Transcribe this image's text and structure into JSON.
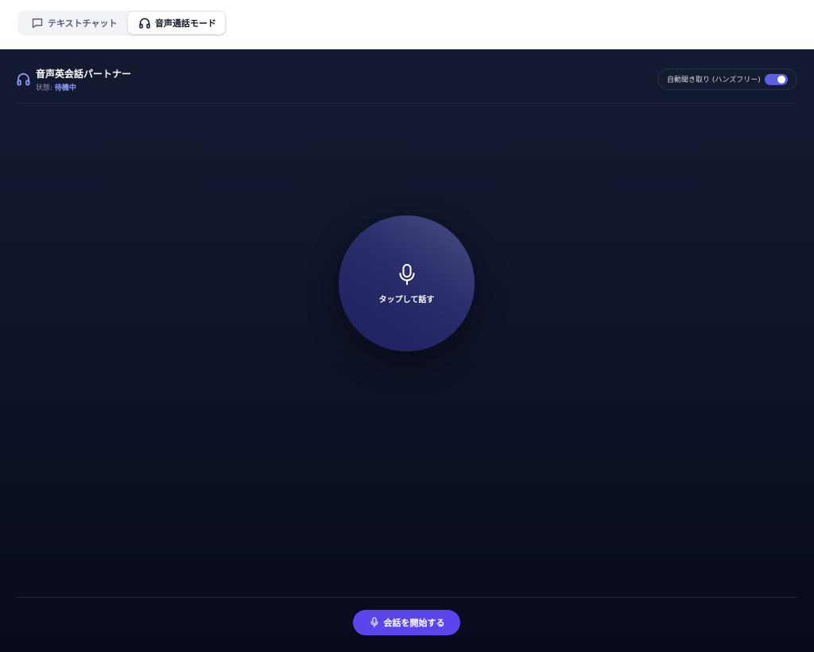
{
  "tabs": [
    {
      "label": "テキストチャット",
      "icon": "chat-bubble-icon",
      "active": false
    },
    {
      "label": "音声通話モード",
      "icon": "headphones-icon",
      "active": true
    }
  ],
  "header": {
    "title": "音声英会話パートナー",
    "status_prefix": "状態: ",
    "status_value": "待機中",
    "icon": "headphones-icon"
  },
  "auto_listen": {
    "label": "自動聞き取り (ハンズフリー)",
    "enabled": true
  },
  "mic": {
    "label": "タップして話す",
    "icon": "microphone-icon"
  },
  "start_button": {
    "label": "会話を開始する",
    "icon": "microphone-icon"
  },
  "colors": {
    "accent": "#5a46ec",
    "status_value": "#8e9bff",
    "panel_bg": "#0d1227",
    "toggle_on": "#5b5fe6"
  }
}
